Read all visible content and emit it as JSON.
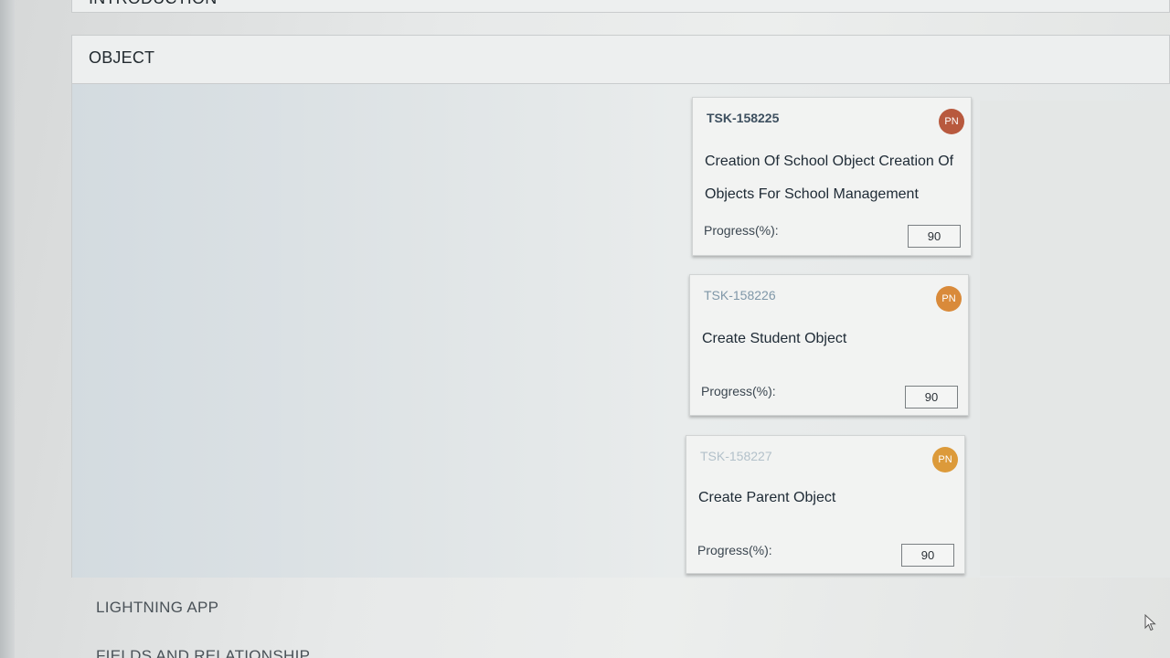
{
  "sections": {
    "introduction": "INTRODUCTION",
    "object": "OBJECT",
    "lightning_app": "LIGHTNING APP",
    "fields_and_relationship": "FIELDS AND RELATIONSHIP"
  },
  "tasks": [
    {
      "id": "TSK-158225",
      "title": "Creation Of School Object Creation Of Objects For School Management",
      "assignee_initials": "PN",
      "avatar_color": "#b8593e",
      "progress_label": "Progress(%):",
      "progress_value": "90"
    },
    {
      "id": "TSK-158226",
      "title": "Create Student Object",
      "assignee_initials": "PN",
      "avatar_color": "#d98a3a",
      "progress_label": "Progress(%):",
      "progress_value": "90"
    },
    {
      "id": "TSK-158227",
      "title": "Create Parent Object",
      "assignee_initials": "PN",
      "avatar_color": "#dc9a3a",
      "progress_label": "Progress(%):",
      "progress_value": "90"
    }
  ],
  "icons": {
    "cursor": "mouse-pointer-icon"
  }
}
